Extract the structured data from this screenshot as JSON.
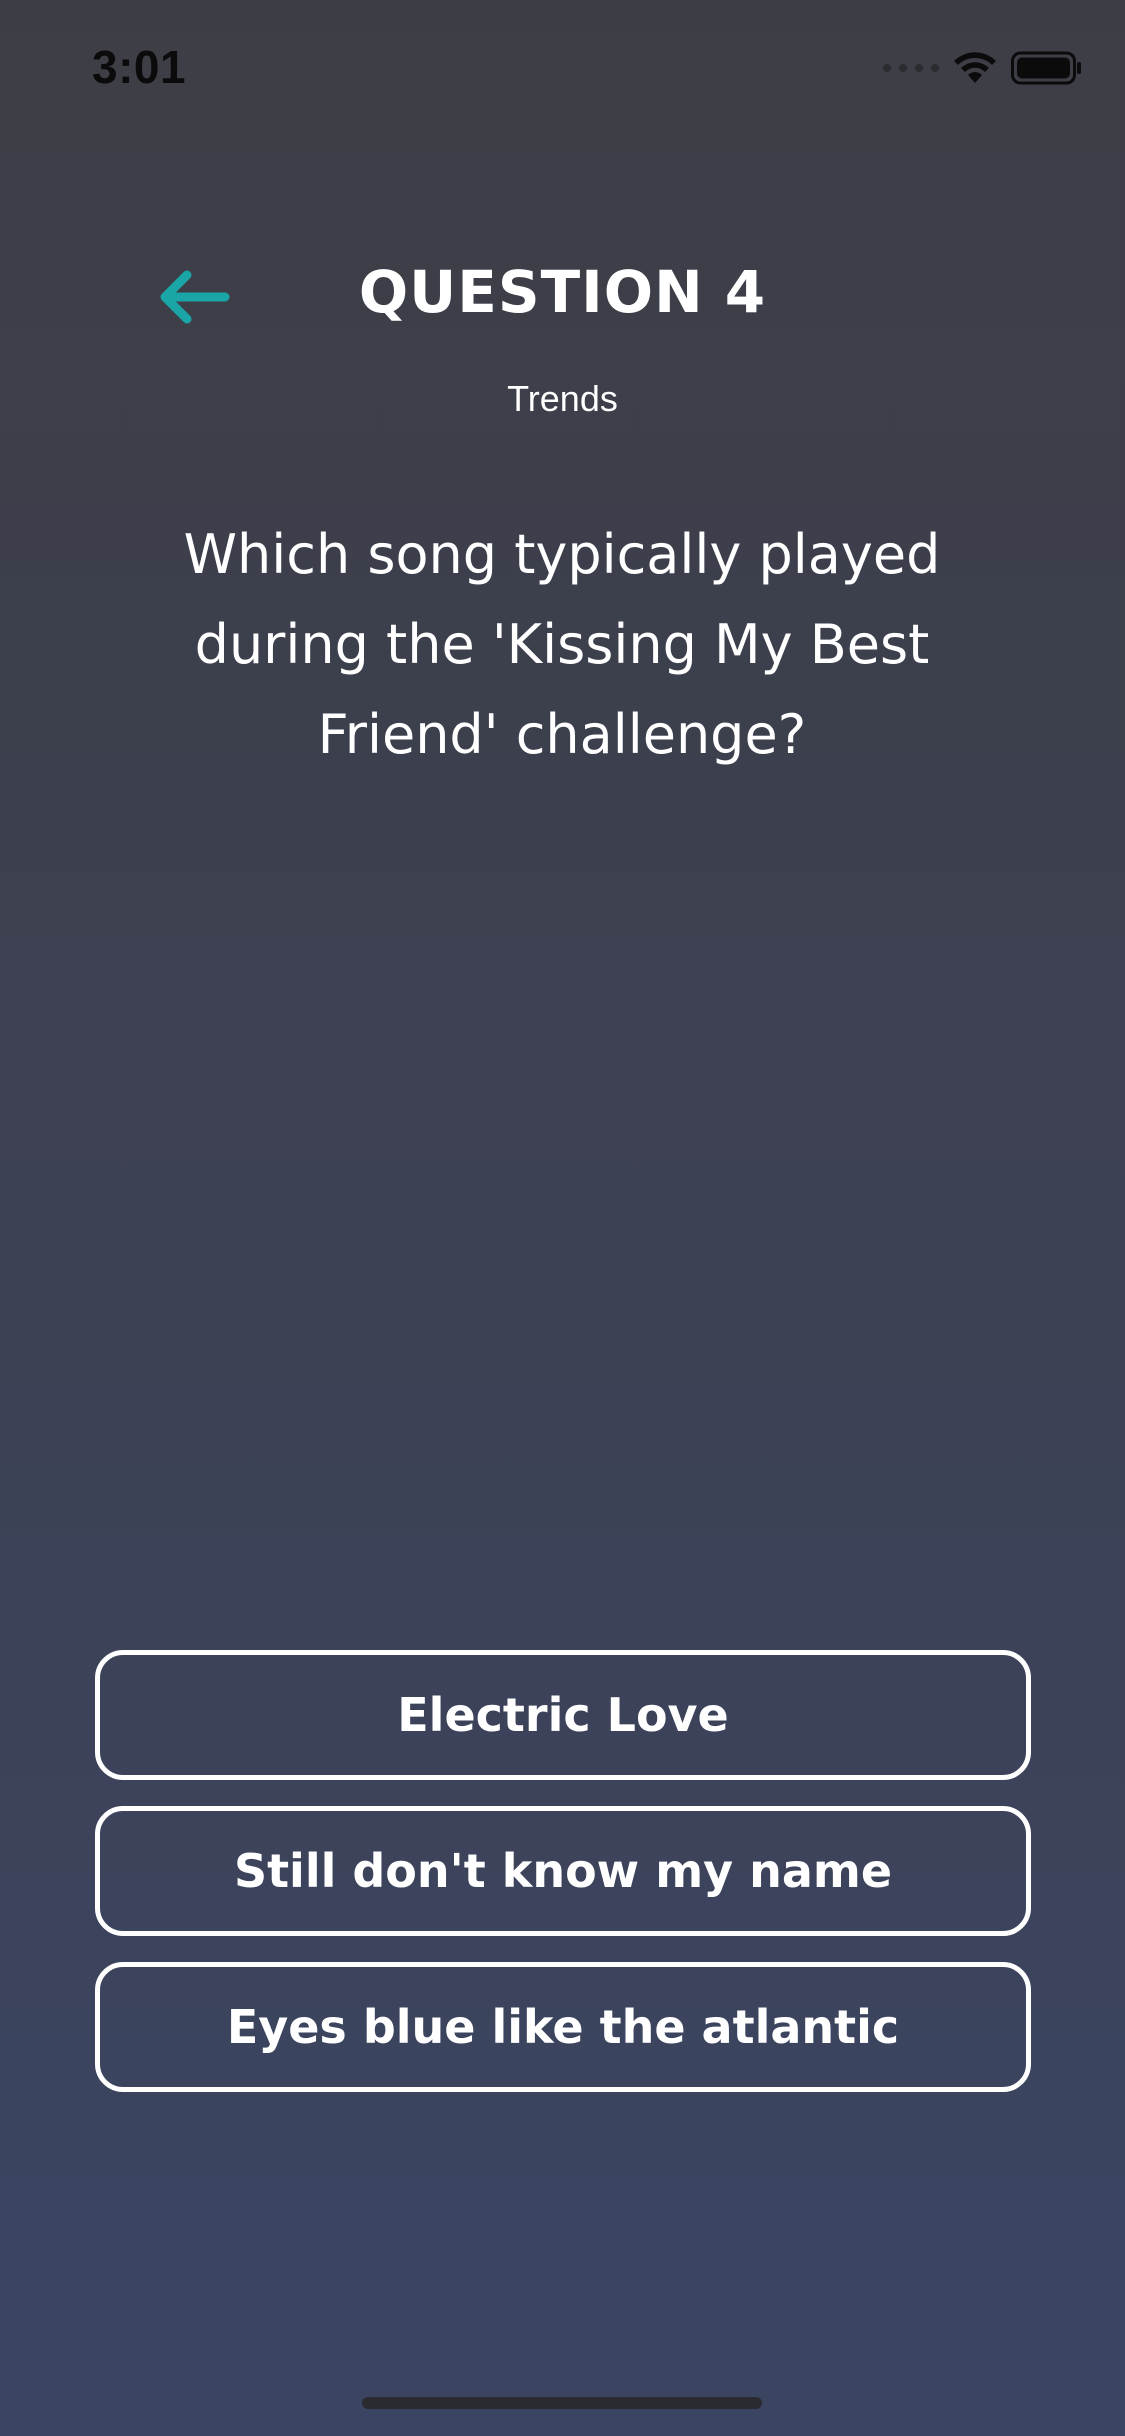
{
  "status_bar": {
    "time": "3:01",
    "icons": [
      "signal-icon",
      "wifi-icon",
      "battery-icon"
    ]
  },
  "header": {
    "back_icon": "arrow-left-icon",
    "title": "QUESTION 4",
    "category": "Trends"
  },
  "question": {
    "text": "Which song typically played during the 'Kissing My Best Friend' challenge?"
  },
  "answers": [
    {
      "label": "Electric Love"
    },
    {
      "label": "Still don't know my name"
    },
    {
      "label": "Eyes blue like the atlantic"
    }
  ],
  "colors": {
    "accent": "#1aa6a6",
    "background_top": "#3d3e45",
    "background_bottom": "#3b4563",
    "text": "#ffffff"
  }
}
